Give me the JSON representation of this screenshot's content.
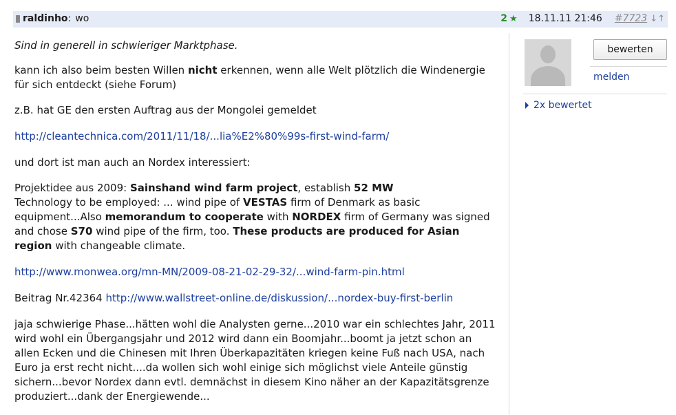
{
  "header": {
    "username": "raldinho",
    "separator": ":",
    "subject": "wo",
    "rating_count": "2",
    "date": "18.11.11 21:46",
    "post_number": "#7723",
    "down_arrow": "↓",
    "up_arrow": "↑"
  },
  "post": {
    "intro": "Sind in generell in schwieriger Marktphase.",
    "p1_a": "kann ich also beim besten Willen ",
    "p1_b": "nicht",
    "p1_c": " erkennen, wenn alle Welt plötzlich die Windenergie für sich entdeckt (siehe Forum)",
    "p2": "z.B. hat GE den ersten Auftrag aus der Mongolei gemeldet",
    "link1": "http://cleantechnica.com/2011/11/18/...lia%E2%80%99s-first-wind-farm/",
    "p3": "und dort ist man auch an Nordex interessiert:",
    "p4_1": "Projektidee aus 2009: ",
    "p4_2": "Sainshand wind farm project",
    "p4_3": ", establish ",
    "p4_4": "52 MW",
    "p4_5": "Technology to be employed: ... wind pipe of ",
    "p4_6": "VESTAS",
    "p4_7": " firm of Denmark as basic equipment...Also ",
    "p4_8": "memorandum to cooperate",
    "p4_9": " with ",
    "p4_10": "NORDEX",
    "p4_11": " firm of Germany was signed and chose ",
    "p4_12": "S70",
    "p4_13": " wind pipe of the firm, too. ",
    "p4_14": "These products are produced for Asian region",
    "p4_15": " with changeable climate.",
    "link2": "http://www.monwea.org/mn-MN/2009-08-21-02-29-32/...wind-farm-pin.html",
    "p5_label": "Beitrag Nr.42364 ",
    "link3": "http://www.wallstreet-online.de/diskussion/...nordex-buy-first-berlin",
    "p6": "jaja schwierige Phase...hätten wohl die Analysten gerne...2010 war ein schlechtes Jahr, 2011 wird wohl ein Übergangsjahr und 2012 wird dann ein Boomjahr...boomt ja jetzt schon an allen Ecken und die Chinesen mit Ihren Überkapazitäten kriegen keine Fuß nach USA, nach Euro ja erst recht nicht....da wollen sich wohl einige sich möglichst viele Anteile günstig sichern...bevor Nordex dann evtl. demnächst in diesem Kino näher an der Kapazitätsgrenze produziert...dank der Energiewende..."
  },
  "sidebar": {
    "rate_button": "bewerten",
    "report_link": "melden",
    "rated_link": "2x bewertet"
  },
  "colors": {
    "header_bg": "#e6ebf8",
    "link": "#1d3f9e",
    "rating_green": "#2e8b2e"
  },
  "icons": [
    "phone-icon",
    "star-icon",
    "avatar-placeholder",
    "triangle-right-icon"
  ]
}
